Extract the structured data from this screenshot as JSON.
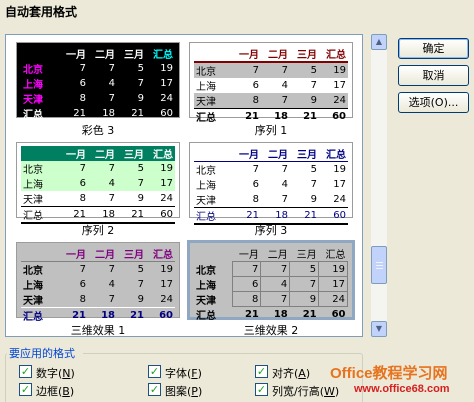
{
  "window": {
    "title": "自动套用格式"
  },
  "buttons": {
    "ok": "确定",
    "cancel": "取消",
    "options": "选项(O)..."
  },
  "table_preview": {
    "header": [
      "",
      "一月",
      "二月",
      "三月",
      "汇总"
    ],
    "rows": [
      [
        "北京",
        "7",
        "7",
        "5",
        "19"
      ],
      [
        "上海",
        "6",
        "4",
        "7",
        "17"
      ],
      [
        "天津",
        "8",
        "7",
        "9",
        "24"
      ],
      [
        "汇总",
        "21",
        "18",
        "21",
        "60"
      ]
    ]
  },
  "formats": [
    {
      "caption": "彩色 3"
    },
    {
      "caption": "序列 1"
    },
    {
      "caption": "序列 2"
    },
    {
      "caption": "序列 3"
    },
    {
      "caption": "三维效果 1"
    },
    {
      "caption": "三维效果 2"
    }
  ],
  "scrollbar": {
    "up_icon": "arrow-up-icon",
    "down_icon": "arrow-down-icon"
  },
  "apply_group": {
    "title": "要应用的格式",
    "options": [
      {
        "label": "数字",
        "key": "N",
        "checked": true
      },
      {
        "label": "字体",
        "key": "F",
        "checked": true
      },
      {
        "label": "对齐",
        "key": "A",
        "checked": true
      },
      {
        "label": "边框",
        "key": "B",
        "checked": true
      },
      {
        "label": "图案",
        "key": "P",
        "checked": true
      },
      {
        "label": "列宽/行高",
        "key": "W",
        "checked": true
      }
    ]
  },
  "watermark": {
    "main": "Office教程学习网",
    "url": "www.office68.com"
  }
}
